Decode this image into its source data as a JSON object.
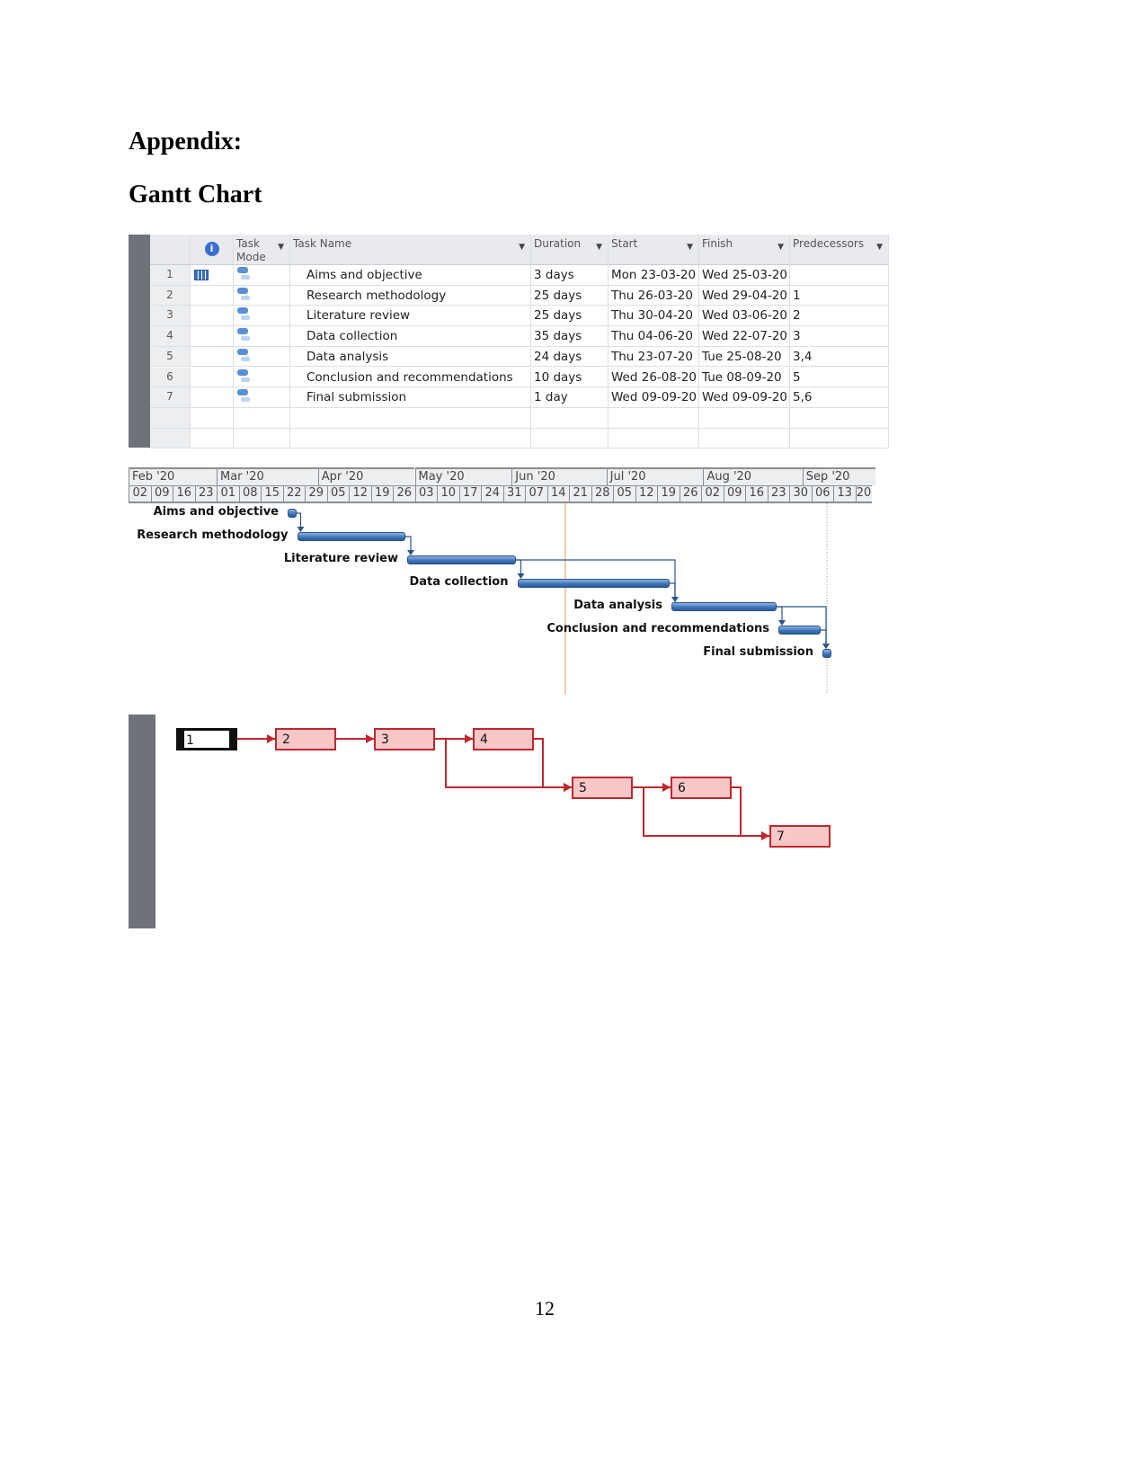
{
  "heading": "Appendix:",
  "subheading": "Gantt Chart",
  "table": {
    "columns": {
      "mode": "Task Mode",
      "name": "Task Name",
      "duration": "Duration",
      "start": "Start",
      "finish": "Finish",
      "predecessors": "Predecessors"
    },
    "info_icon": "info-icon",
    "rows": [
      {
        "id": "1",
        "name": "Aims and objective",
        "duration": "3 days",
        "start": "Mon 23-03-20",
        "finish": "Wed 25-03-20",
        "predecessors": ""
      },
      {
        "id": "2",
        "name": "Research methodology",
        "duration": "25 days",
        "start": "Thu 26-03-20",
        "finish": "Wed 29-04-20",
        "predecessors": "1"
      },
      {
        "id": "3",
        "name": "Literature review",
        "duration": "25 days",
        "start": "Thu 30-04-20",
        "finish": "Wed 03-06-20",
        "predecessors": "2"
      },
      {
        "id": "4",
        "name": "Data collection",
        "duration": "35 days",
        "start": "Thu 04-06-20",
        "finish": "Wed 22-07-20",
        "predecessors": "3"
      },
      {
        "id": "5",
        "name": "Data analysis",
        "duration": "24 days",
        "start": "Thu 23-07-20",
        "finish": "Tue 25-08-20",
        "predecessors": "3,4"
      },
      {
        "id": "6",
        "name": "Conclusion and recommendations",
        "duration": "10 days",
        "start": "Wed 26-08-20",
        "finish": "Tue 08-09-20",
        "predecessors": "5"
      },
      {
        "id": "7",
        "name": "Final submission",
        "duration": "1 day",
        "start": "Wed 09-09-20",
        "finish": "Wed 09-09-20",
        "predecessors": "5,6"
      }
    ]
  },
  "timeline": {
    "months": [
      "Feb '20",
      "Mar '20",
      "Apr '20",
      "May '20",
      "Jun '20",
      "Jul '20",
      "Aug '20",
      "Sep '20"
    ],
    "weeks": [
      "02",
      "09",
      "16",
      "23",
      "01",
      "08",
      "15",
      "22",
      "29",
      "05",
      "12",
      "19",
      "26",
      "03",
      "10",
      "17",
      "24",
      "31",
      "07",
      "14",
      "21",
      "28",
      "05",
      "12",
      "19",
      "26",
      "02",
      "09",
      "16",
      "23",
      "30",
      "06",
      "13",
      "20"
    ],
    "bar_color": "#3d72b8"
  },
  "network": {
    "nodes": [
      "1",
      "2",
      "3",
      "4",
      "5",
      "6",
      "7"
    ],
    "color": "#c0272d",
    "fill": "#f9c7c8"
  },
  "page_number": "12"
}
